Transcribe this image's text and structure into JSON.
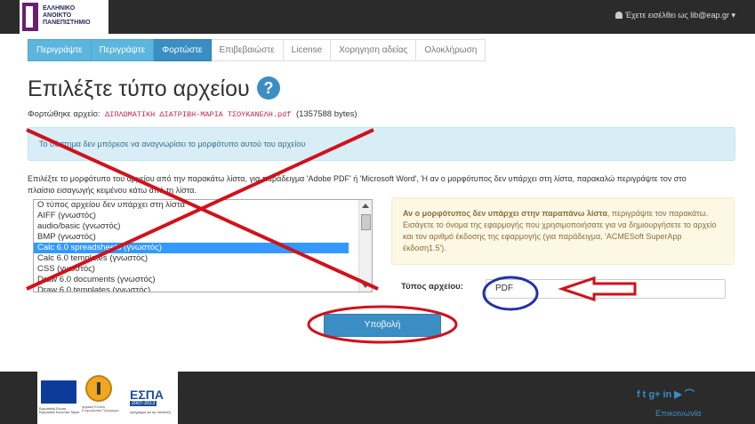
{
  "header": {
    "logo_text": [
      "ΕΛΛΗΝΙΚΟ",
      "ΑΝΟΙΚΤΟ",
      "ΠΑΝΕΠΙΣΤΗΜΙΟ"
    ],
    "login_text": "Έχετε εισέλθει ως lib@eap.gr",
    "caret": "▾"
  },
  "tabs": [
    {
      "label": "Περιγράψτε",
      "state": "done"
    },
    {
      "label": "Περιγράψτε",
      "state": "done"
    },
    {
      "label": "Φορτώστε",
      "state": "active"
    },
    {
      "label": "Επιβεβαιώστε",
      "state": "todo"
    },
    {
      "label": "License",
      "state": "todo"
    },
    {
      "label": "Χορηγηση αδείας",
      "state": "todo"
    },
    {
      "label": "Ολοκλήρωση",
      "state": "todo"
    }
  ],
  "page": {
    "title": "Επιλέξτε τύπο αρχείου",
    "help_glyph": "?",
    "uploaded_label": "Φορτώθηκε αρχείο:",
    "uploaded_file": "ΔΙΠΛΩΜΑΤΙΚΗ ΔΙΑΤΡΙΒΗ-ΜΑΡΙΑ ΤΣΟΥΚΑΝΕΛΗ.pdf",
    "uploaded_size": "(1357588 bytes)",
    "info_message": "Το σύστημα δεν μπόρεσε να αναγνωρίσει το μορφότυπο αυτού του αρχείου",
    "instructions": "Επιλέξτε το μορφότυπο του αρχείου από την παρακάτω λίστα, για παράδειγμα 'Adobe PDF' ή 'Microsoft Word', Ή αν ο μορφότυπος δεν υπάρχει στη λίστα, παρακαλώ περιγράψτε τον στο πλαίσιο εισαγωγής κειμένου κάτω από τη λίστα.",
    "format_options": [
      "Ο τύπος αρχείου δεν υπάρχει στη λίστα",
      "AIFF (γνωστός)",
      "audio/basic (γνωστός)",
      "BMP (γνωστός)",
      "Calc 6.0 spreadsheets (γνωστός)",
      "Calc 6.0 templates (γνωστός)",
      "CSS (γνωστός)",
      "Draw 6.0 documents (γνωστός)",
      "Draw 6.0 templates (γνωστός)"
    ],
    "selected_index": 4,
    "warn_bold": "Αν ο μορφότυπος δεν υπάρχει στην παραπάνω λίστα",
    "warn_text": ", περιγράψτε τον παρακάτω. Εισάγετε το όνομα της εφαρμογής που χρησιμοποιήσατε για να δημιουργήσετε το αρχείο και τον αριθμό έκδοσης της εφαρμογής (για παράδειγμα, 'ACMESoft SuperApp έκδοση1.5').",
    "filetype_label": "Τύπος αρχείου:",
    "filetype_value": "PDF",
    "submit_label": "Υποβολή"
  },
  "footer": {
    "eu_caption": "Ευρωπαϊκή Ένωση Ευρωπαϊκό Κοινωνικό Ταμείο",
    "medal_caption": "ψηφιακή Ελλάδα Επιχειρησιακό Πρόγραμμα",
    "espa_title": "ΕΣΠΑ",
    "espa_years": "2007-2013",
    "espa_caption": "πρόγραμμα για την ανάπτυξη",
    "social_icons": [
      "facebook-icon",
      "twitter-icon",
      "googleplus-icon",
      "linkedin-icon",
      "youtube-icon",
      "rss-icon"
    ],
    "social_glyphs": [
      "f",
      "t",
      "g+",
      "in",
      "▶",
      "⌒"
    ],
    "contact": "Επικοινωνία"
  },
  "colors": {
    "annotation_red": "#d0121b",
    "annotation_blue": "#2430a8",
    "accent": "#3a8ec4"
  }
}
